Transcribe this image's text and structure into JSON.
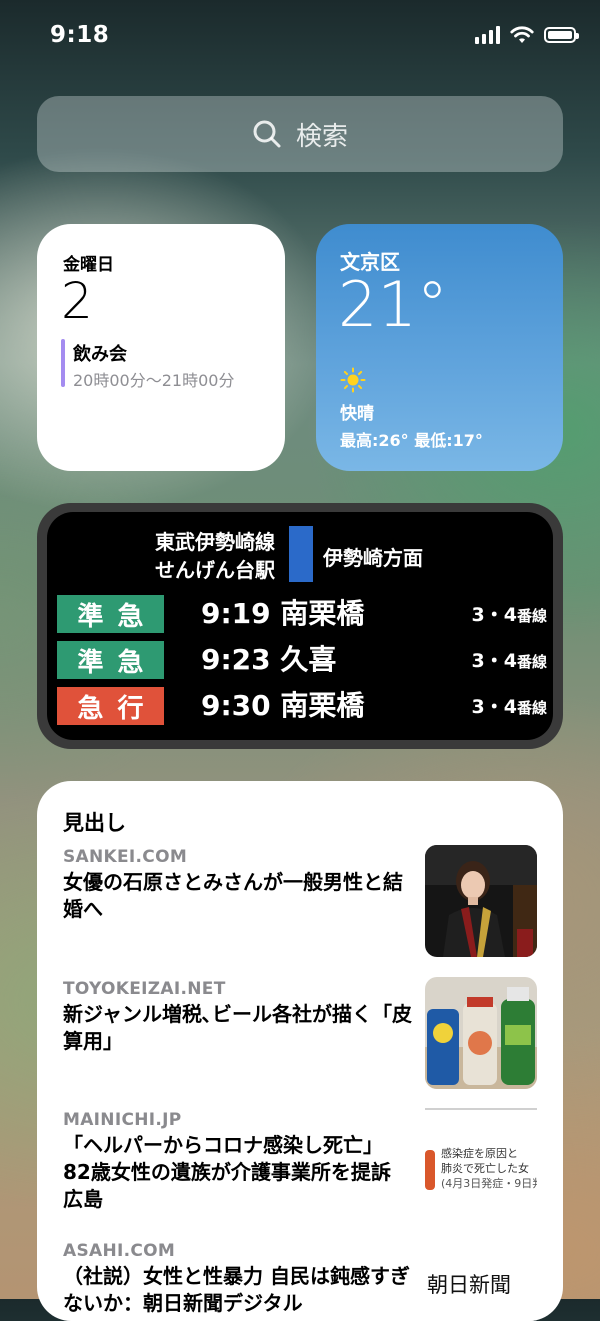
{
  "status_bar": {
    "time": "9:18"
  },
  "search": {
    "placeholder": "検索"
  },
  "calendar": {
    "weekday": "金曜日",
    "day": "2",
    "event_title": "飲み会",
    "event_time": "20時00分〜21時00分",
    "event_color": "#a48cf0"
  },
  "weather": {
    "city": "文京区",
    "temperature": "21°",
    "condition": "快晴",
    "high_low": "最高:26° 最低:17°",
    "icon": "sun-icon"
  },
  "train": {
    "line": "東武伊勢崎線",
    "station": "せんげん台駅",
    "direction": "伊勢崎方面",
    "line_color": "#2b6ac9",
    "departures": [
      {
        "type": "準急",
        "type_color": "#2e9a72",
        "time": "9:19",
        "destination": "南栗橋",
        "platform": "3・4",
        "platform_suffix": "番線"
      },
      {
        "type": "準急",
        "type_color": "#2e9a72",
        "time": "9:23",
        "destination": "久喜",
        "platform": "3・4",
        "platform_suffix": "番線"
      },
      {
        "type": "急行",
        "type_color": "#e0523a",
        "time": "9:30",
        "destination": "南栗橋",
        "platform": "3・4",
        "platform_suffix": "番線"
      }
    ]
  },
  "news": {
    "header": "見出し",
    "items": [
      {
        "source": "SANKEI.COM",
        "title": "女優の石原さとみさんが一般男性と結婚へ"
      },
      {
        "source": "TOYOKEIZAI.NET",
        "title": "新ジャンル増税､ビール各社が描く「皮算用」"
      },
      {
        "source": "MAINICHI.JP",
        "title": "「ヘルパーからコロナ感染し死亡」 82歳女性の遺族が介護事業所を提訴 広島",
        "thumb_text": [
          "感染症を原因と",
          "肺炎で死亡した女",
          "(4月3日発症・9日判"
        ]
      },
      {
        "source": "ASAHI.COM",
        "title": "（社説）女性と性暴力 自民は鈍感すぎないか：朝日新聞デジタル",
        "thumb_text": [
          "朝日新聞"
        ]
      }
    ]
  }
}
